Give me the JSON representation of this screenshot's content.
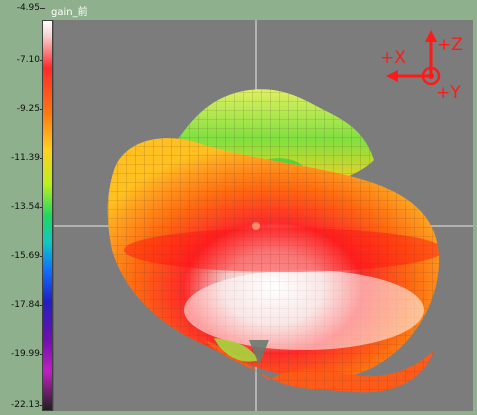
{
  "colorbar": {
    "title": "gain_前",
    "ticks": [
      "-4.95",
      "-7.10",
      "-9.25",
      "-11.39",
      "-13.54",
      "-15.69",
      "-17.84",
      "-19.99",
      "-22.13"
    ]
  },
  "axes": {
    "z_label": "+Z",
    "x_label": "+X",
    "y_label": "+Y"
  },
  "colors": {
    "viewport_bg": "#7c7c7c",
    "frame_bg": "#8fb08d",
    "axis_indicator": "#ff1a1a"
  }
}
